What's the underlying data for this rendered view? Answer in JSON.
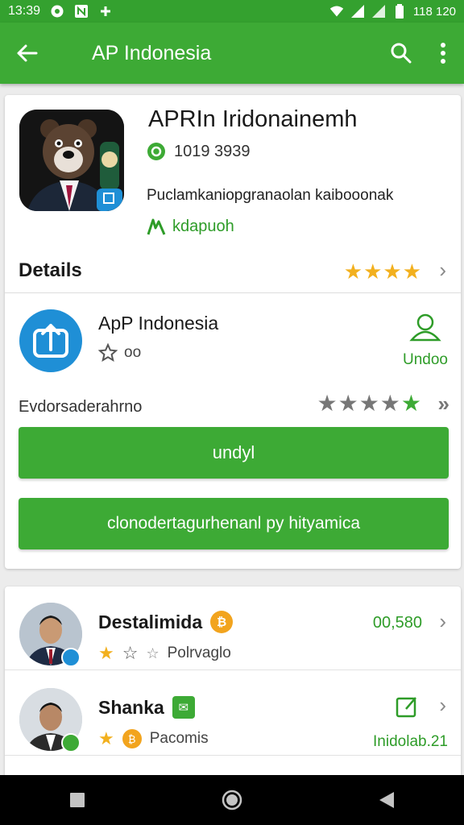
{
  "status_bar": {
    "time": "13:39",
    "battery_text": "118 120",
    "icons": [
      "media-icon",
      "notification-icon",
      "add-icon",
      "wifi-icon",
      "signal-icon",
      "signal-icon",
      "battery-icon"
    ]
  },
  "app_bar": {
    "title": "AP Indonesia",
    "back_icon": "back-arrow-icon",
    "search_icon": "search-icon",
    "menu_icon": "overflow-menu-icon"
  },
  "app_header": {
    "name": "APRIn Iridonainemh",
    "meta_count": "1019 3939",
    "description": "Puclamkaniopgranaolan kaibooonak",
    "download_label": "kdapuoh"
  },
  "details": {
    "label": "Details",
    "stars": 4
  },
  "sub_app": {
    "name": "ApP Indonesia",
    "fav_label": "oo",
    "user_label": "Undoo"
  },
  "rating": {
    "label": "Evdorsaderahrno",
    "grey_stars": 4,
    "green_stars": 1
  },
  "buttons": {
    "primary": "undyl",
    "secondary": "clonodertagurhenanl py hityamica"
  },
  "people": [
    {
      "name": "Destalimida",
      "badge": "₿",
      "sub": "Polrvaglo",
      "value": "00,580",
      "stars": 1
    },
    {
      "name": "Shanka",
      "badge": "✉",
      "sub": "Pacomis",
      "value": "Inidolab.21"
    }
  ],
  "colors": {
    "primary_green": "#3daa35",
    "dark_green": "#2e9c28",
    "star_gold": "#f2b01e",
    "accent_blue": "#1f8fd6"
  }
}
